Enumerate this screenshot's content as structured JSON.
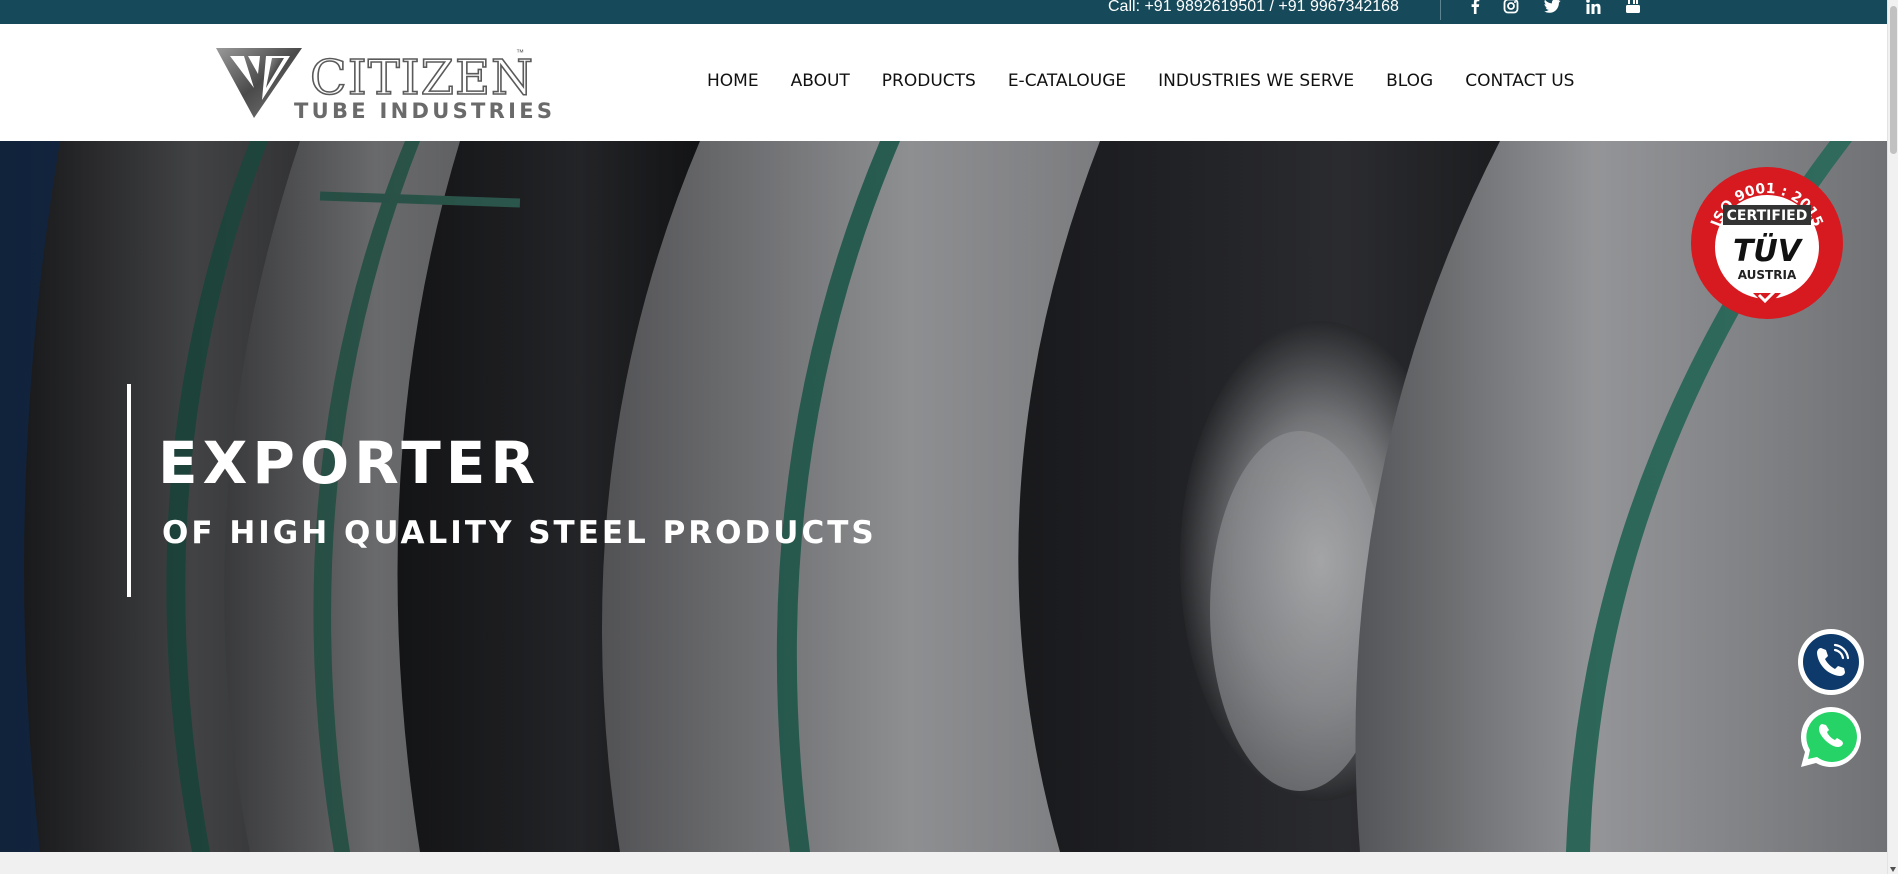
{
  "topbar": {
    "call_text": "Call: +91 9892619501 / +91 9967342168",
    "social": [
      "facebook-icon",
      "instagram-icon",
      "twitter-icon",
      "linkedin-icon",
      "youtube-icon"
    ]
  },
  "logo": {
    "brand": "CITIZEN",
    "trademark": "™",
    "tagline": "TUBE INDUSTRIES"
  },
  "nav": {
    "items": [
      "HOME",
      "ABOUT",
      "PRODUCTS",
      "E-CATALOUGE",
      "INDUSTRIES WE SERVE",
      "BLOG",
      "CONTACT US"
    ]
  },
  "hero": {
    "title": "EXPORTER",
    "subtitle": "OF HIGH QUALITY STEEL PRODUCTS"
  },
  "badge": {
    "top_text": "ISO 9001 : 2015",
    "certified": "CERTIFIED",
    "mark": "TÜV",
    "country": "AUSTRIA"
  },
  "colors": {
    "topbar": "#164a5a",
    "badge_red": "#d71920",
    "phone_button": "#0d3a6b",
    "whatsapp_button": "#25d366"
  }
}
